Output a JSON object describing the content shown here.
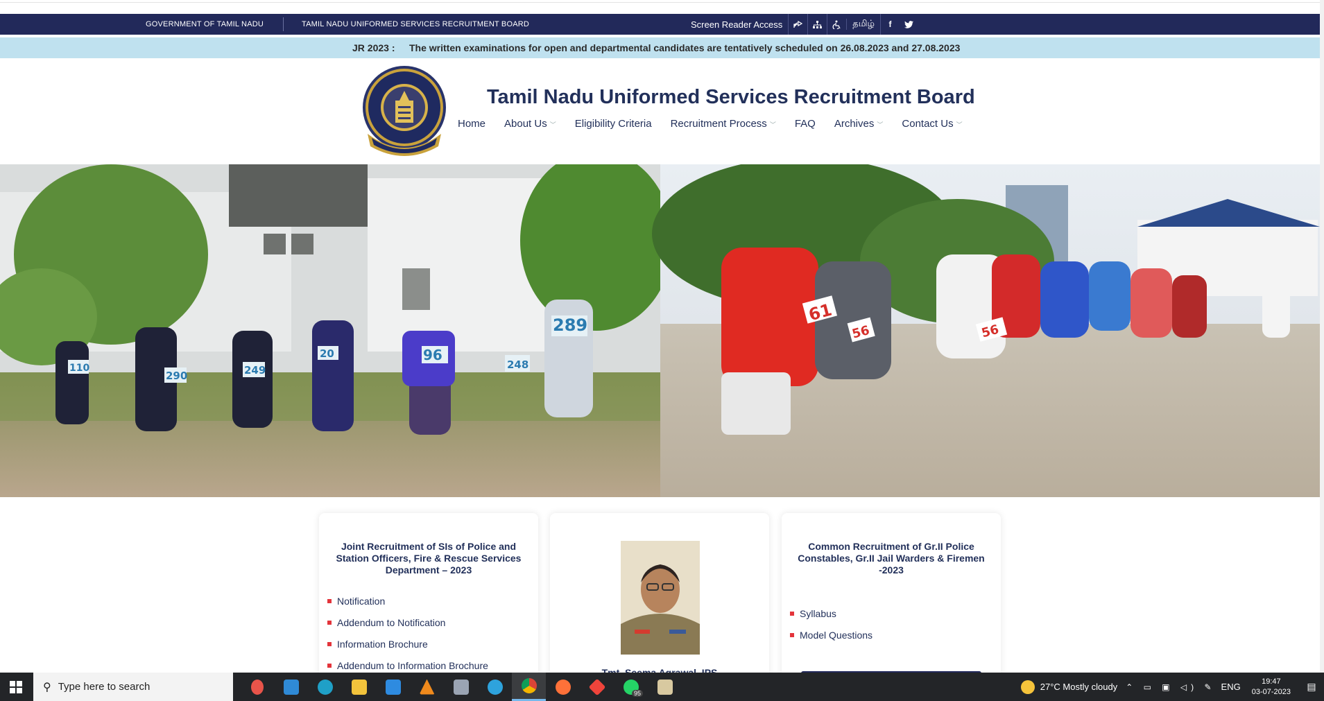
{
  "gov_bar": {
    "left_1": "GOVERNMENT OF TAMIL NADU",
    "left_2": "TAMIL NADU UNIFORMED SERVICES RECRUITMENT BOARD",
    "screen_reader": "Screen Reader Access",
    "lang": "தமிழ்",
    "icons": [
      "share-icon",
      "sitemap-icon",
      "accessibility-icon",
      "facebook-icon",
      "twitter-icon"
    ]
  },
  "ticker": {
    "label": "JR 2023 :",
    "message": "The written examinations for open and departmental candidates are tentatively scheduled on 26.08.2023 and 27.08.2023"
  },
  "header": {
    "title": "Tamil Nadu Uniformed Services Recruitment Board",
    "nav": [
      {
        "label": "Home",
        "dropdown": false
      },
      {
        "label": "About Us",
        "dropdown": true
      },
      {
        "label": "Eligibility Criteria",
        "dropdown": false
      },
      {
        "label": "Recruitment Process",
        "dropdown": true
      },
      {
        "label": "FAQ",
        "dropdown": false
      },
      {
        "label": "Archives",
        "dropdown": true
      },
      {
        "label": "Contact Us",
        "dropdown": true
      }
    ],
    "logo_text": [
      "GOVERNMENT OF TAMIL NADU",
      "TRUTH ALONE TRIUMPHS",
      "INTEGRITY OBJECTIVITY IMPARTIALITY"
    ]
  },
  "hero": {
    "bibs_left": [
      "110",
      "290",
      "249",
      "20",
      "96",
      "248",
      "289"
    ],
    "bibs_right": [
      "61",
      "56",
      "56"
    ]
  },
  "cards": {
    "card1": {
      "title": "Joint Recruitment of SIs of Police and Station Officers, Fire & Rescue Services Department – 2023",
      "links": [
        "Notification",
        "Addendum to Notification",
        "Information Brochure",
        "Addendum to Information Brochure"
      ]
    },
    "card2": {
      "name": "Tmt. Seema Agrawal, IPS"
    },
    "card3": {
      "title": "Common Recruitment of Gr.II Police Constables, Gr.II Jail Warders & Firemen -2023",
      "links": [
        "Syllabus",
        "Model Questions"
      ]
    }
  },
  "taskbar": {
    "search_placeholder": "Type here to search",
    "whatsapp_badge": "95",
    "weather": "27°C  Mostly cloudy",
    "lang": "ENG",
    "time": "19:47",
    "date": "03-07-2023"
  },
  "colors": {
    "navy": "#22295a",
    "ticker_bg": "#bfe1ef",
    "bullet_red": "#e3343b"
  }
}
